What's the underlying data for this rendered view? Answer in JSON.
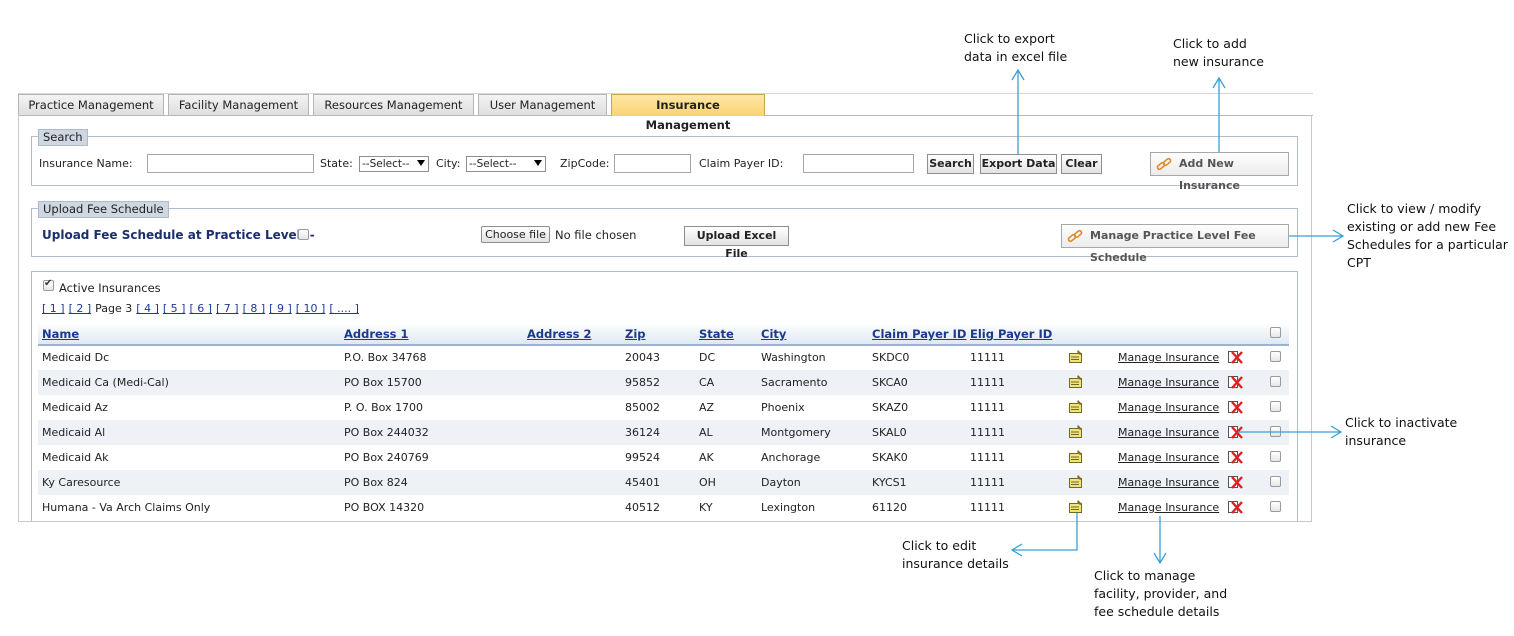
{
  "tabs": [
    "Practice Management",
    "Facility Management",
    "Resources Management",
    "User Management",
    "Insurance Management"
  ],
  "active_tab": "Insurance Management",
  "search": {
    "legend": "Search",
    "insurance_name_label": "Insurance Name:",
    "insurance_name_value": "",
    "state_label": "State:",
    "state_value": "--Select--",
    "city_label": "City:",
    "city_value": "--Select--",
    "zip_label": "ZipCode:",
    "zip_value": "",
    "claim_payer_label": "Claim Payer ID:",
    "claim_payer_value": "",
    "search_button": "Search",
    "export_button": "Export Data",
    "clear_button": "Clear",
    "add_new_button": "Add New Insurance"
  },
  "upload": {
    "legend": "Upload Fee Schedule",
    "practice_level_label": "Upload Fee Schedule at Practice Level :-",
    "choose_file_button": "Choose file",
    "no_file_text": "No file chosen",
    "upload_button": "Upload Excel File",
    "manage_fee_button": "Manage Practice Level Fee Schedule"
  },
  "list": {
    "active_label": "Active Insurances",
    "pages_before": [
      "[ 1 ]",
      "[ 2 ]"
    ],
    "current_page": "Page 3",
    "pages_after": [
      "[ 4 ]",
      "[ 5 ]",
      "[ 6 ]",
      "[ 7 ]",
      "[ 8 ]",
      "[ 9 ]",
      "[ 10 ]",
      "[ .... ]"
    ],
    "columns": [
      "Name",
      "Address 1",
      "Address 2",
      "Zip",
      "State",
      "City",
      "Claim Payer ID",
      "Elig Payer ID"
    ],
    "manage_link": "Manage Insurance",
    "rows": [
      {
        "name": "Medicaid Dc",
        "address1": "P.O. Box 34768",
        "address2": "",
        "zip": "20043",
        "state": "DC",
        "city": "Washington",
        "claim_payer_id": "SKDC0",
        "elig_payer_id": "11111"
      },
      {
        "name": "Medicaid Ca (Medi-Cal)",
        "address1": "PO Box 15700",
        "address2": "",
        "zip": "95852",
        "state": "CA",
        "city": "Sacramento",
        "claim_payer_id": "SKCA0",
        "elig_payer_id": "11111"
      },
      {
        "name": "Medicaid Az",
        "address1": "P. O. Box 1700",
        "address2": "",
        "zip": "85002",
        "state": "AZ",
        "city": "Phoenix",
        "claim_payer_id": "SKAZ0",
        "elig_payer_id": "11111"
      },
      {
        "name": "Medicaid Al",
        "address1": "PO Box 244032",
        "address2": "",
        "zip": "36124",
        "state": "AL",
        "city": "Montgomery",
        "claim_payer_id": "SKAL0",
        "elig_payer_id": "11111"
      },
      {
        "name": "Medicaid Ak",
        "address1": "PO Box 240769",
        "address2": "",
        "zip": "99524",
        "state": "AK",
        "city": "Anchorage",
        "claim_payer_id": "SKAK0",
        "elig_payer_id": "11111"
      },
      {
        "name": "Ky Caresource",
        "address1": "PO Box 824",
        "address2": "",
        "zip": "45401",
        "state": "OH",
        "city": "Dayton",
        "claim_payer_id": "KYCS1",
        "elig_payer_id": "11111"
      },
      {
        "name": "Humana - Va Arch Claims Only",
        "address1": "PO BOX 14320",
        "address2": "",
        "zip": "40512",
        "state": "KY",
        "city": "Lexington",
        "claim_payer_id": "61120",
        "elig_payer_id": "11111"
      }
    ]
  },
  "annotations": {
    "export": [
      "Click to export",
      "data in excel file"
    ],
    "add_new": [
      "Click to add",
      "new insurance"
    ],
    "fee_schedule": [
      "Click to view / modify",
      "existing or add new Fee",
      "Schedules for a particular",
      "CPT"
    ],
    "inactivate": [
      "Click to inactivate",
      "insurance"
    ],
    "edit": [
      "Click to edit",
      "insurance details"
    ],
    "manage": [
      "Click to manage",
      "facility, provider, and",
      "fee schedule details"
    ]
  },
  "colors": {
    "active_tab": "#fbd373",
    "header_text": "#1b3a8a",
    "annotation_arrow": "#3a9fd6",
    "delete_icon": "#e02020"
  }
}
